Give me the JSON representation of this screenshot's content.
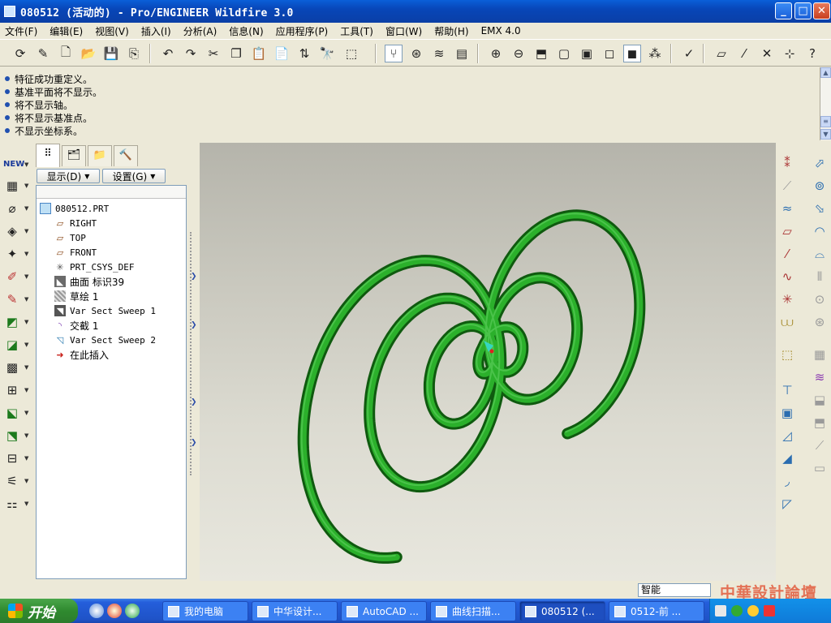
{
  "window": {
    "title": "080512 (活动的) - Pro/ENGINEER Wildfire 3.0"
  },
  "menu": {
    "items": [
      "文件(F)",
      "编辑(E)",
      "视图(V)",
      "插入(I)",
      "分析(A)",
      "信息(N)",
      "应用程序(P)",
      "工具(T)",
      "窗口(W)",
      "帮助(H)",
      "EMX 4.0"
    ]
  },
  "messages": [
    "特征成功重定义。",
    "基准平面将不显示。",
    "将不显示轴。",
    "将不显示基准点。",
    "不显示坐标系。"
  ],
  "model_tree": {
    "tabs": [
      "model-tree",
      "layers",
      "favorites",
      "tools"
    ],
    "display_label": "显示(D)",
    "settings_label": "设置(G)",
    "items": [
      {
        "label": "080512.PRT",
        "icon": "part-icon"
      },
      {
        "label": "RIGHT",
        "icon": "datum-plane-icon"
      },
      {
        "label": "TOP",
        "icon": "datum-plane-icon"
      },
      {
        "label": "FRONT",
        "icon": "datum-plane-icon"
      },
      {
        "label": "PRT_CSYS_DEF",
        "icon": "csys-icon"
      },
      {
        "label": "曲面 标识39",
        "icon": "surface-icon"
      },
      {
        "label": "草绘 1",
        "icon": "sketch-icon"
      },
      {
        "label": "Var Sect Sweep 1",
        "icon": "sweep-icon"
      },
      {
        "label": "交截 1",
        "icon": "intersect-icon"
      },
      {
        "label": "Var Sect Sweep 2",
        "icon": "sweep-icon"
      },
      {
        "label": "在此插入",
        "icon": "insert-here-arrow-icon"
      }
    ]
  },
  "status": {
    "filter_value": "智能",
    "watermark": "中華設計論壇"
  },
  "taskbar": {
    "start_label": "开始",
    "tasks": [
      "我的电脑",
      "中华设计...",
      "AutoCAD ...",
      "曲线扫描...",
      "080512 (...",
      "0512-前 ..."
    ]
  },
  "colors": {
    "spring": "#1f8a1f",
    "viewport_top": "#b5b4ab",
    "viewport_bottom": "#e8e7de",
    "titlebar": "#0a5fd8",
    "taskbar": "#245edb"
  }
}
